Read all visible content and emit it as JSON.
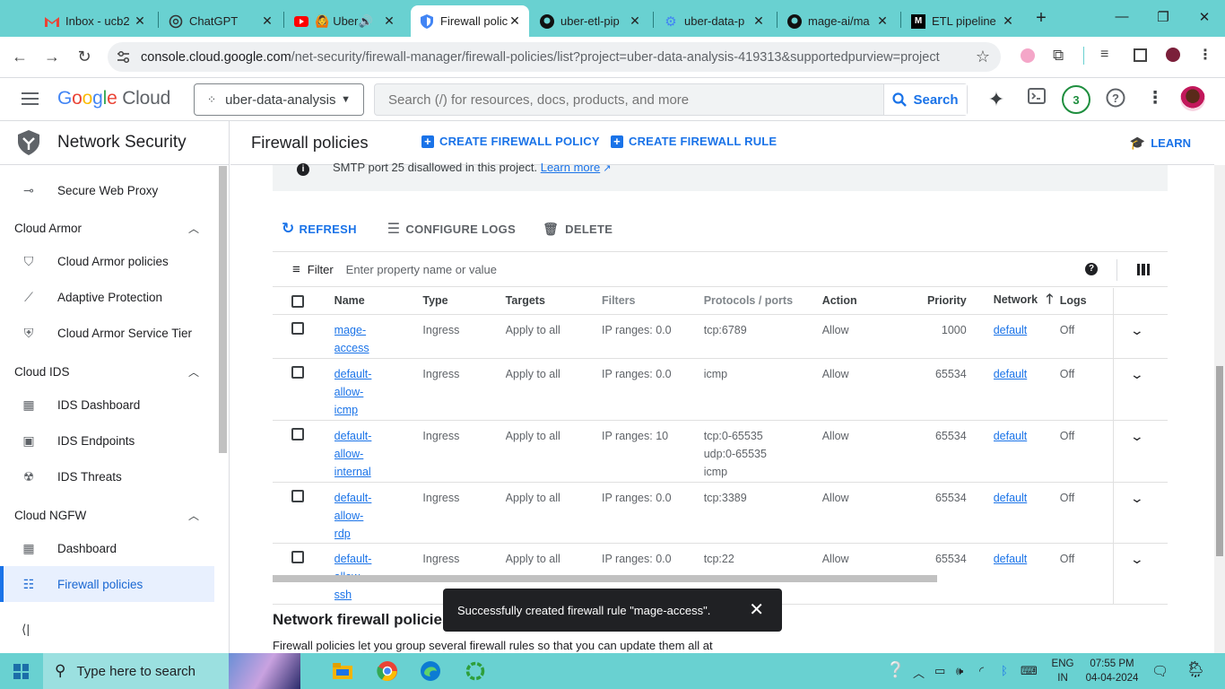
{
  "browser": {
    "tabs": [
      {
        "title": "Inbox - ucb2",
        "icon": "gmail-icon"
      },
      {
        "title": "ChatGPT",
        "icon": "chatgpt-icon"
      },
      {
        "title": "Uber",
        "icon": "youtube-icon"
      },
      {
        "title": "Firewall polic",
        "icon": "shield-icon",
        "active": true
      },
      {
        "title": "uber-etl-pip",
        "icon": "github-icon"
      },
      {
        "title": "uber-data-p",
        "icon": "gear-icon"
      },
      {
        "title": "mage-ai/ma",
        "icon": "github-icon"
      },
      {
        "title": "ETL pipeline",
        "icon": "medium-icon"
      }
    ],
    "url_host": "console.cloud.google.com",
    "url_path": "/net-security/firewall-manager/firewall-policies/list?project=uber-data-analysis-419313&supportedpurview=project"
  },
  "header": {
    "logo_google": "Google",
    "logo_cloud": "Cloud",
    "project": "uber-data-analysis",
    "search_placeholder": "Search (/) for resources, docs, products, and more",
    "search_button": "Search",
    "notif_count": "3"
  },
  "sidebar": {
    "title": "Network Security",
    "items": [
      {
        "label": "Secure Web Proxy"
      },
      {
        "group": "Cloud Armor"
      },
      {
        "label": "Cloud Armor policies"
      },
      {
        "label": "Adaptive Protection"
      },
      {
        "label": "Cloud Armor Service Tier"
      },
      {
        "group": "Cloud IDS"
      },
      {
        "label": "IDS Dashboard"
      },
      {
        "label": "IDS Endpoints"
      },
      {
        "label": "IDS Threats"
      },
      {
        "group": "Cloud NGFW"
      },
      {
        "label": "Dashboard"
      },
      {
        "label": "Firewall policies",
        "selected": true
      }
    ]
  },
  "main": {
    "title": "Firewall policies",
    "create_policy": "CREATE FIREWALL POLICY",
    "create_rule": "CREATE FIREWALL RULE",
    "learn": "LEARN",
    "info_text": "SMTP port 25 disallowed in this project.",
    "info_link": "Learn more",
    "refresh": "REFRESH",
    "configure_logs": "CONFIGURE LOGS",
    "delete": "DELETE",
    "filter_label": "Filter",
    "filter_placeholder": "Enter property name or value",
    "columns": [
      "Name",
      "Type",
      "Targets",
      "Filters",
      "Protocols / ports",
      "Action",
      "Priority",
      "Network",
      "Logs"
    ],
    "rows": [
      {
        "name": "mage-access",
        "type": "Ingress",
        "targets": "Apply to all",
        "filters": "IP ranges: 0.0",
        "protocols": [
          "tcp:6789"
        ],
        "action": "Allow",
        "priority": "1000",
        "network": "default",
        "logs": "Off"
      },
      {
        "name": "default-allow-icmp",
        "type": "Ingress",
        "targets": "Apply to all",
        "filters": "IP ranges: 0.0",
        "protocols": [
          "icmp"
        ],
        "action": "Allow",
        "priority": "65534",
        "network": "default",
        "logs": "Off"
      },
      {
        "name": "default-allow-internal",
        "type": "Ingress",
        "targets": "Apply to all",
        "filters": "IP ranges: 10",
        "protocols": [
          "tcp:0-65535",
          "udp:0-65535",
          "icmp"
        ],
        "action": "Allow",
        "priority": "65534",
        "network": "default",
        "logs": "Off"
      },
      {
        "name": "default-allow-rdp",
        "type": "Ingress",
        "targets": "Apply to all",
        "filters": "IP ranges: 0.0",
        "protocols": [
          "tcp:3389"
        ],
        "action": "Allow",
        "priority": "65534",
        "network": "default",
        "logs": "Off"
      },
      {
        "name": "default-allow-ssh",
        "type": "Ingress",
        "targets": "Apply to all",
        "filters": "IP ranges: 0.0",
        "protocols": [
          "tcp:22"
        ],
        "action": "Allow",
        "priority": "65534",
        "network": "default",
        "logs": "Off"
      }
    ],
    "section_title": "Network firewall policies",
    "section_desc": "Firewall policies let you group several firewall rules so that you can update them all at"
  },
  "toast": {
    "message": "Successfully created firewall rule \"mage-access\"."
  },
  "taskbar": {
    "search_placeholder": "Type here to search",
    "lang_line1": "ENG",
    "lang_line2": "IN",
    "time": "07:55 PM",
    "date": "04-04-2024"
  },
  "colors": {
    "accent": "#1a73e8",
    "taskbar": "#69d1d1",
    "selected_bg": "#e8f0fe"
  }
}
